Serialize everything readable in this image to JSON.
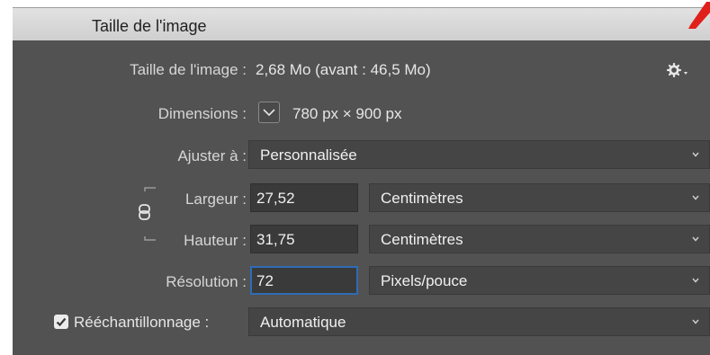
{
  "dialog": {
    "title": "Taille de l'image"
  },
  "image_size": {
    "label": "Taille de l'image :",
    "value": "2,68 Mo (avant : 46,5 Mo)"
  },
  "dimensions": {
    "label": "Dimensions :",
    "value": "780 px  ×  900 px"
  },
  "fit_to": {
    "label": "Ajuster à :",
    "selected": "Personnalisée"
  },
  "width": {
    "label": "Largeur :",
    "value": "27,52",
    "unit": "Centimètres"
  },
  "height": {
    "label": "Hauteur :",
    "value": "31,75",
    "unit": "Centimètres"
  },
  "resolution": {
    "label": "Résolution :",
    "value": "72",
    "unit": "Pixels/pouce"
  },
  "resample": {
    "label": "Rééchantillonnage :",
    "checked": true,
    "selected": "Automatique"
  },
  "icons": {
    "settings": "gear-icon",
    "link": "chain-link-icon",
    "dimension_toggle": "chevron-down-icon",
    "dropdown": "chevron-down-icon",
    "checkbox": "checkmark-icon"
  },
  "colors": {
    "panel_bg": "#525252",
    "titlebar_bg": "#d9d9d9",
    "focus": "#2f6cb5",
    "corner_mark": "#e0201b"
  }
}
